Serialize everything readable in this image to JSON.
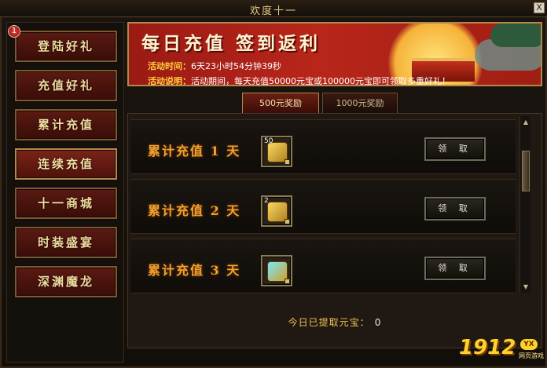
{
  "window": {
    "title": "欢度十一",
    "close_label": "X"
  },
  "sidebar": {
    "badge": "1",
    "items": [
      {
        "label": "登陆好礼"
      },
      {
        "label": "充值好礼"
      },
      {
        "label": "累计充值"
      },
      {
        "label": "连续充值",
        "active": true
      },
      {
        "label": "十一商城"
      },
      {
        "label": "时装盛宴"
      },
      {
        "label": "深渊魔龙"
      }
    ]
  },
  "banner": {
    "headline": "每日充值 签到返利",
    "time_key": "活动时间：",
    "time_value": "6天23小时54分钟39秒",
    "desc_key": "活动说明：",
    "desc_value": "活动期间，每天充值50000元宝或100000元宝即可领取多重好礼！"
  },
  "tabs": [
    {
      "label": "500元奖励",
      "active": true
    },
    {
      "label": "1000元奖励",
      "active": false
    }
  ],
  "rows": [
    {
      "label": "累计充值 1 天",
      "item_qty": "50",
      "claim": "领 取"
    },
    {
      "label": "累计充值 2 天",
      "item_qty": "2",
      "claim": "领 取"
    },
    {
      "label": "累计充值 3 天",
      "item_qty": "",
      "claim": "领 取"
    }
  ],
  "footer": {
    "today_label": "今日已提取元宝：",
    "today_value": "0"
  },
  "logo": {
    "number": "1912",
    "badge": "YX",
    "sub": "网页游戏"
  },
  "colors": {
    "accent": "#f0a030",
    "banner": "#b8261a",
    "button_active": "#7a241a"
  },
  "icons": {
    "scroll_up": "triangle-up-icon",
    "scroll_down": "triangle-down-icon"
  }
}
